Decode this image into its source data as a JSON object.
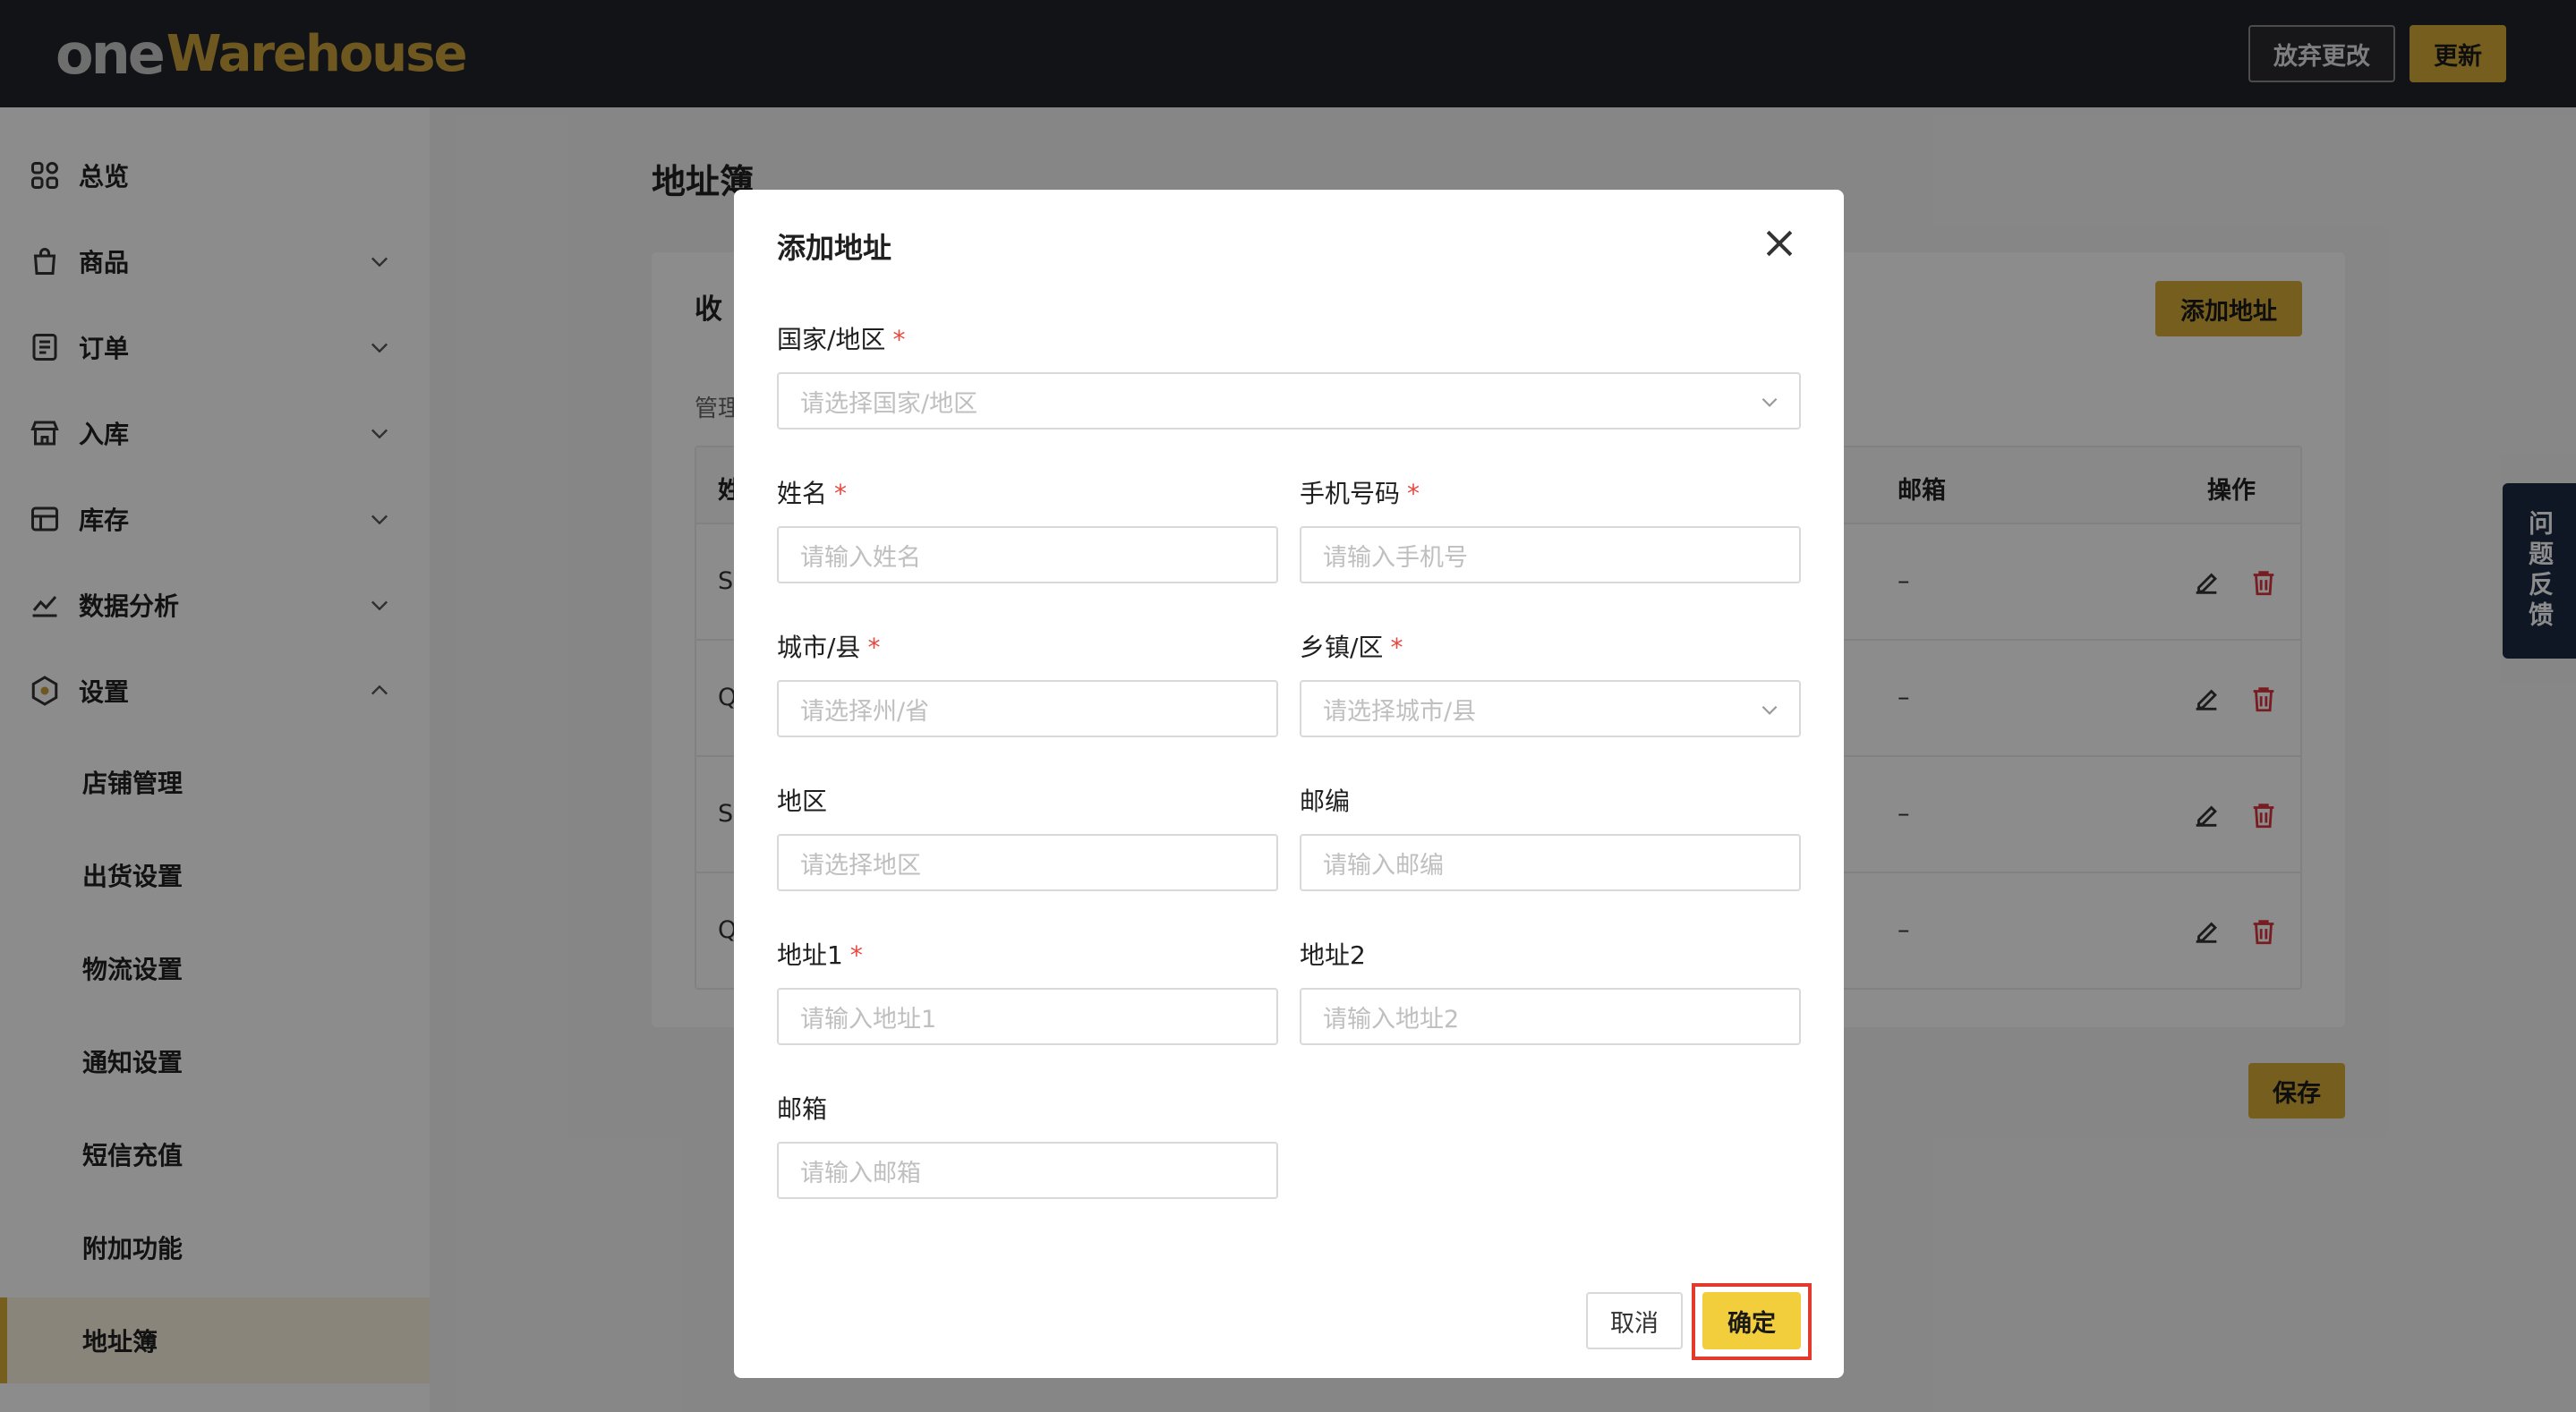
{
  "header": {
    "logo_one": "one",
    "logo_warehouse": "Warehouse",
    "discard_label": "放弃更改",
    "update_label": "更新"
  },
  "sidebar": {
    "items": [
      {
        "label": "总览",
        "icon": "grid-icon",
        "has_chevron": false
      },
      {
        "label": "商品",
        "icon": "bag-icon",
        "chevron": "down"
      },
      {
        "label": "订单",
        "icon": "order-list-icon",
        "chevron": "down"
      },
      {
        "label": "入库",
        "icon": "store-icon",
        "chevron": "down"
      },
      {
        "label": "库存",
        "icon": "inventory-icon",
        "chevron": "down"
      },
      {
        "label": "数据分析",
        "icon": "chart-icon",
        "chevron": "down"
      },
      {
        "label": "设置",
        "icon": "settings-hex-icon",
        "chevron": "up"
      }
    ],
    "sub_items": [
      {
        "label": "店铺管理"
      },
      {
        "label": "出货设置"
      },
      {
        "label": "物流设置"
      },
      {
        "label": "通知设置"
      },
      {
        "label": "短信充值"
      },
      {
        "label": "附加功能"
      },
      {
        "label": "地址簿",
        "active": true
      }
    ]
  },
  "main": {
    "page_title": "地址簿",
    "card_title": "收",
    "card_sub": "管理",
    "add_button": "添加地址",
    "save_button": "保存",
    "table": {
      "headers": {
        "first": "姓",
        "email": "邮箱",
        "actions": "操作"
      },
      "rows": [
        {
          "first": "S",
          "email": "–"
        },
        {
          "first": "Q",
          "email": "–"
        },
        {
          "first": "S",
          "email": "–"
        },
        {
          "first": "Q",
          "email": "–"
        }
      ]
    }
  },
  "feedback_label": "问题反馈",
  "modal": {
    "title": "添加地址",
    "fields": {
      "country": {
        "label": "国家/地区",
        "required": true,
        "placeholder": "请选择国家/地区"
      },
      "name": {
        "label": "姓名",
        "required": true,
        "placeholder": "请输入姓名"
      },
      "phone": {
        "label": "手机号码",
        "required": true,
        "placeholder": "请输入手机号"
      },
      "city": {
        "label": "城市/县",
        "required": true,
        "placeholder": "请选择州/省"
      },
      "town": {
        "label": "乡镇/区",
        "required": true,
        "placeholder": "请选择城市/县"
      },
      "region": {
        "label": "地区",
        "required": false,
        "placeholder": "请选择地区"
      },
      "postcode": {
        "label": "邮编",
        "required": false,
        "placeholder": "请输入邮编"
      },
      "address1": {
        "label": "地址1",
        "required": true,
        "placeholder": "请输入地址1"
      },
      "address2": {
        "label": "地址2",
        "required": false,
        "placeholder": "请输入地址2"
      },
      "email": {
        "label": "邮箱",
        "required": false,
        "placeholder": "请输入邮箱"
      }
    },
    "required_mark": "*",
    "cancel_label": "取消",
    "confirm_label": "确定"
  },
  "colors": {
    "topbar": "#222329",
    "accent": "#d8ae38",
    "confirm": "#f2cd3c",
    "highlight_outline": "#e23b2e",
    "required": "#e8483f",
    "feedback_bg": "#1c2a44"
  }
}
